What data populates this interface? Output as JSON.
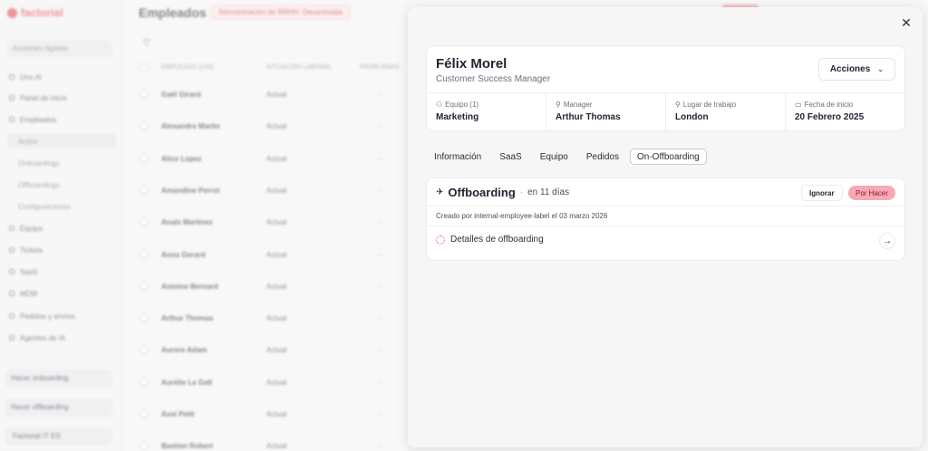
{
  "app": {
    "logo": "factorial",
    "page_title": "Empleados",
    "sync_badge": "Sincronización de RRHH: Desactivada"
  },
  "sidebar": {
    "quick_actions": "Acciones rápidas",
    "items": [
      {
        "label": "Uno AI",
        "sub": false
      },
      {
        "label": "Panel de inicio",
        "sub": false
      },
      {
        "label": "Empleados",
        "sub": false
      },
      {
        "label": "Activo",
        "sub": true,
        "active": true
      },
      {
        "label": "Onboardings",
        "sub": true
      },
      {
        "label": "Offboardings",
        "sub": true
      },
      {
        "label": "Configuraciones",
        "sub": true
      },
      {
        "label": "Equipo",
        "sub": false
      },
      {
        "label": "Tickets",
        "sub": false
      },
      {
        "label": "SaaS",
        "sub": false
      },
      {
        "label": "MDM",
        "sub": false
      },
      {
        "label": "Pedidos y envíos",
        "sub": false
      },
      {
        "label": "Agentes de IA",
        "sub": false
      }
    ],
    "onboarding_btn": "Hacer onboarding",
    "offboarding_btn": "Hacer offboarding",
    "company": "Factorial IT ES"
  },
  "table": {
    "headers": [
      "EMPLEADO (143)",
      "SITUACIÓN LABORAL",
      "PROBLEMAS"
    ],
    "rows": [
      {
        "name": "Gaël Girard",
        "status": "Actual",
        "issues": "–"
      },
      {
        "name": "Alexandre Martin",
        "status": "Actual",
        "issues": "–"
      },
      {
        "name": "Alice Lopez",
        "status": "Actual",
        "issues": "–"
      },
      {
        "name": "Amandine Perrot",
        "status": "Actual",
        "issues": "–"
      },
      {
        "name": "Anaïs Martinez",
        "status": "Actual",
        "issues": "–"
      },
      {
        "name": "Anna Gerard",
        "status": "Actual",
        "issues": "–"
      },
      {
        "name": "Antoine Bernard",
        "status": "Actual",
        "issues": "–"
      },
      {
        "name": "Arthur Thomas",
        "status": "Actual",
        "issues": "–"
      },
      {
        "name": "Aurore Adam",
        "status": "Actual",
        "issues": "–"
      },
      {
        "name": "Aurélie Le Gall",
        "status": "Actual",
        "issues": "–"
      },
      {
        "name": "Axel Petit",
        "status": "Actual",
        "issues": "–"
      },
      {
        "name": "Bastien Robert",
        "status": "Actual",
        "issues": "–"
      }
    ]
  },
  "modal": {
    "close_icon": "✕",
    "employee": {
      "name": "Félix Morel",
      "role": "Customer Success Manager",
      "actions_label": "Acciones",
      "team_label": "Equipo (1)",
      "team_value": "Marketing",
      "manager_label": "Manager",
      "manager_value": "Arthur Thomas",
      "location_label": "Lugar de trabajo",
      "location_value": "London",
      "start_label": "Fecha de inicio",
      "start_value": "20 Febrero 2025"
    },
    "tabs": [
      "Información",
      "SaaS",
      "Equipo",
      "Pedidos",
      "On-Offboarding"
    ],
    "active_tab": 4,
    "offboarding": {
      "title": "Offboarding",
      "separator": "·",
      "days": "en 11 días",
      "ignore_label": "Ignorar",
      "status_badge": "Por Hacer",
      "created_text": "Creado por internal-employee-label el 03 marzo 2026",
      "details_label": "Detalles de offboarding"
    }
  },
  "colors": {
    "brand": "#e5484d",
    "todo_badge": "#f6a8b4"
  }
}
